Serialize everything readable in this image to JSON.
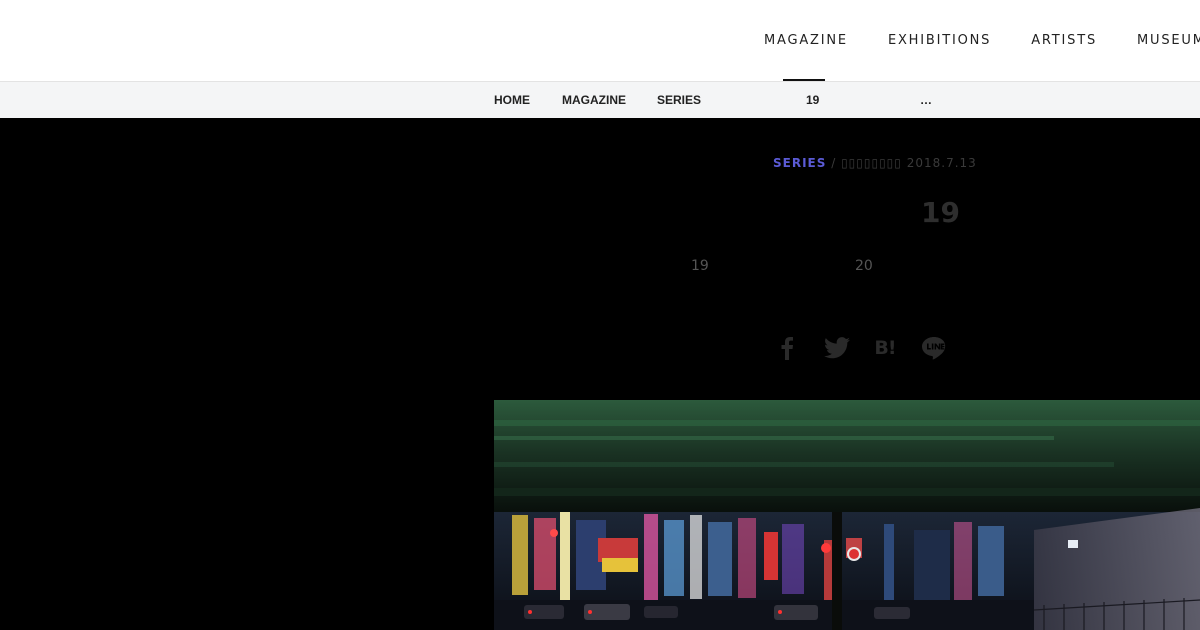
{
  "nav": {
    "items": [
      {
        "label": "MAGAZINE",
        "active": true
      },
      {
        "label": "EXHIBITIONS",
        "active": false
      },
      {
        "label": "ARTISTS",
        "active": false
      },
      {
        "label": "MUSEUMS",
        "active": false
      }
    ]
  },
  "breadcrumb": {
    "items": [
      "HOME",
      "MAGAZINE",
      "SERIES",
      "19",
      "…"
    ]
  },
  "article": {
    "category": "SERIES",
    "separator": " / ",
    "author": "▯▯▯▯▯▯▯▯",
    "date": "2018.7.13",
    "title_num": "19",
    "sub_left": "19",
    "sub_right": "20"
  },
  "share": {
    "icons": [
      "facebook-icon",
      "twitter-icon",
      "hatena-bookmark-icon",
      "line-icon"
    ],
    "hatena_label": "B!"
  },
  "colors": {
    "accent": "#5b5bd6",
    "hero_bg": "#000000",
    "nav_underline": "#111111"
  }
}
